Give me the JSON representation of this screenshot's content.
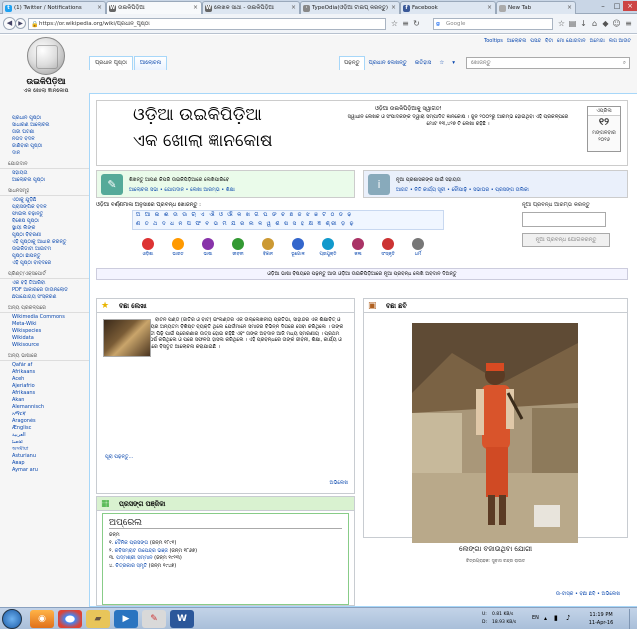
{
  "browser": {
    "tabs": [
      {
        "label": "(1) Twitter / Notifications",
        "icon": "twitter-icon",
        "color": "#1da1f2"
      },
      {
        "label": "ଉଇକିପିଡ଼ିଆ",
        "icon": "wikipedia-icon",
        "color": "#666666",
        "active": true
      },
      {
        "label": "ଲେଖକ ସାଥୀ - ଉଇକିପିଡ଼ିଆ",
        "icon": "wikipedia-icon",
        "color": "#666666"
      },
      {
        "label": "TypeOdia(ଓଡ଼ିଆ ଟାଇପ୍ କରନ୍ତୁ)",
        "icon": "page-icon",
        "color": "#888888"
      },
      {
        "label": "Facebook",
        "icon": "facebook-icon",
        "color": "#3b5998"
      },
      {
        "label": "New Tab",
        "icon": "blank-icon",
        "color": "#aaaaaa"
      }
    ],
    "url": "https://or.wikipedia.org/wiki/ପ୍ରଧାନ_ପୃଷ୍ଠା",
    "search_placeholder": "Google"
  },
  "wiki": {
    "personal_links": [
      "Tooltips",
      "ଆଲୋଚନା",
      "ପସନ୍ଦ",
      "ବିଟା",
      "ମୋ ଯୋଗଦାନ",
      "ଅମେଗା",
      "ଲଗ ଆଉଟ"
    ],
    "logo_title": "ଉଇକିପିଡ଼ିଆ",
    "logo_subtitle": "ଏକ ଖୋଲା ଜ୍ଞାନକୋଷ",
    "tabs_left": [
      "ପ୍ରଧାନ ପୃଷ୍ଠା",
      "ଆଲୋଚନା"
    ],
    "tabs_right": [
      "ପଢ଼ନ୍ତୁ",
      "ପ୍ରଧାନ ଲେଖନ୍ତୁ",
      "ଇତିହାସ",
      "☆",
      "▾"
    ],
    "search_placeholder": "ଖୋଜନ୍ତୁ",
    "sidebar": [
      {
        "heading": "",
        "links": [
          "ପ୍ରଧାନ ପୃଷ୍ଠା",
          "ସାଧାରଣ ଆଲୋଚନା",
          "ତାଜା ଘଟଣା",
          "ନଗଦ ବଦଳ",
          "ଜାଣିବାର ପୃଷ୍ଠା",
          "ଦାନ"
        ]
      },
      {
        "heading": "ଯୋଗଦାନ",
        "links": [
          "ସହାୟତା",
          "ଆଲୋଚନା ପୃଷ୍ଠା"
        ]
      },
      {
        "heading": "ସାଧନସମୂହ",
        "links": [
          "ଏଠାକୁ ଯୁଡ଼ିଛି",
          "ପ୍ରାସଙ୍ଗିକ ବଦଳ",
          "ଫାଇଲ ଚଢ଼ାନ୍ତୁ",
          "ବିଶେଷ ପୃଷ୍ଠା",
          "ସ୍ଥାୟୀ ଲିଙ୍କ",
          "ପୃଷ୍ଠା ବିବରଣୀ",
          "ଏହି ପୃଷ୍ଠାକୁ ଆଧାର କରନ୍ତୁ",
          "ଉଇକିଡାଟା ଆଇଟମ",
          "ପୃଷ୍ଠା ଛାପନ୍ତୁ",
          "ଏହି ପୃଷ୍ଠା ବାବଦରେ"
        ]
      },
      {
        "heading": "ପ୍ରିଣ୍ଟ/ଏକ୍ସପୋର୍ଟ",
        "links": [
          "ଏକ ବହି ତିଆରିବା",
          "PDF ଆକାରରେ ଡାଉନଲୋଡ",
          "ଛପାଯୋଗ୍ୟ ସଂସ୍କରଣ"
        ]
      },
      {
        "heading": "ଅନ୍ୟ ପ୍ରକଳ୍ପରେ",
        "links": [
          "Wikimedia Commons",
          "Meta-Wiki",
          "Wikispecies",
          "Wikidata",
          "Wikisource"
        ]
      },
      {
        "heading": "ଅନ୍ୟ ଭାଷାରେ",
        "links": [
          "Qafár af",
          "Afrikaans",
          "Aceh",
          "Ajeriafrio",
          "Afrikaans",
          "Akan",
          "Alemannisch",
          "አማርኛ",
          "Aragonés",
          "Ænglisc",
          "العربية",
          "ܐܪܡܝܐ",
          "অসমীয়া",
          "Asturianu",
          "Авар",
          "Aymar aru"
        ]
      }
    ],
    "welcome": {
      "title1": "ଓଡ଼ିଆ ଉଇକିପିଡ଼ିଆ",
      "title2": "ଏକ ଖୋଲା ଜ୍ଞାନକୋଷ",
      "welcome_line": "ଓଡ଼ିଆ ଉଇକିପିଡ଼ିଆକୁ ସ୍ୱାଗତ!",
      "description": "ସ୍ୱାଧୀନ ଲେଖକ ଓ ସଂପାଦକଙ୍କ ଦ୍ୱାରା ସମ୍ପାଦିତ ଜ୍ଞାନକୋଷ । ଜୁନ ୨୦୦୨ରୁ ଆରମ୍ଭ ହୋଇଥିବା ଏହି ପ୍ରକଳ୍ପରେ ମୋଟ ୧୩,୪୨୭ ଟି ଲେଖା ରହିଛି ।"
    },
    "calendar": {
      "month": "ଏପ୍ରିଲ",
      "day": "୧୨",
      "weekday": "ମଙ୍ଗଳବାର",
      "year": "୨୦୧୬"
    },
    "info_left": {
      "line1": "ଶିଖନ୍ତୁ ଆପଣ କିପରି ଉଇକିପିଡ଼ିଆରେ ଲେଖିପାରିବେ",
      "line2": "ଆଲୋଚନା ସଭା • ଯୋଗଦାନ • ଲେଖା ଆରମ୍ଭ • ଶିକ୍ଷା"
    },
    "info_right": {
      "line1": "ନୂଆ ପ୍ରଶାସକଙ୍କ ପାଇଁ ସହାୟତା",
      "line2": "ଆଗତ • ନିତି କାର୍ଯ୍ୟ ସୂଚୀ • ଚୌପାଢ଼ି • ସଭାଘର • ପ୍ରସଙ୍ଗ ତାଲିକା"
    },
    "browse_label": "ଓଡ଼ିଆ ବର୍ଣ୍ଣମାଳା ଅନୁସାରେ ପ୍ରବନ୍ଧ ଖୋଜନ୍ତୁ :",
    "alphabet_rows": [
      "ଅ ଆ ଇ ଈ ଉ ଊ ଋ ଏ ଐ ଓ ଔ କ ଖ ଗ ଘ ଙ ଚ ଛ ଜ ଝ ଞ ଟ ଠ ଡ ଢ",
      "ଣ ତ ଥ ଦ ଧ ନ ପ ଫ ବ ଭ ମ ଯ ର ଲ ଳ ୱ ଶ ଷ ସ ହ କ୍ଷ ଜ୍ଞ ଶ୍ରୀ ଡ଼ ଢ଼"
    ],
    "portals": [
      {
        "label": "ଓଡ଼ିଶା",
        "color": "#d33"
      },
      {
        "label": "ଭାରତ",
        "color": "#f90"
      },
      {
        "label": "ଭାଷା",
        "color": "#83a"
      },
      {
        "label": "ଜୀବନୀ",
        "color": "#393"
      },
      {
        "label": "ବିଜ୍ଞାନ",
        "color": "#c93"
      },
      {
        "label": "ଭୂଗୋଳ",
        "color": "#36c"
      },
      {
        "label": "ପ୍ରଯୁକ୍ତି",
        "color": "#19c"
      },
      {
        "label": "କଳା",
        "color": "#a36"
      },
      {
        "label": "ସଂସ୍କୃତି",
        "color": "#c33"
      },
      {
        "label": "ଧର୍ମ",
        "color": "#777"
      }
    ],
    "search_box": {
      "label": "ନୂଆ ପ୍ରବନ୍ଧ ଆରମ୍ଭ କରନ୍ତୁ",
      "button": "ନୂଆ ପ୍ରବନ୍ଧ ଯୋଗକରନ୍ତୁ"
    },
    "notice": "ଓଡ଼ିଆ ଭାଷା ବିଷୟରେ ପଢ଼ନ୍ତୁ ଆଉ ଓଡ଼ିଆ ଉଇକିପିଡ଼ିଆରେ ନୂଆ ପ୍ରବନ୍ଧ ଲେଖି ଅବଦାନ ଦିଅନ୍ତୁ",
    "featured": {
      "heading": "ବଛା ଲେଖା",
      "text": "ବାଟନ ପଣ୍ଡ (ଜାତିର ଓ ବାଟ) ଇଂଲଣ୍ଡର ଏକ ଉଲ୍ଲେଖନୀୟ ପ୍ରତିଭା, ସାହାନ୍ଦର ଏକ ଶିକ୍ଷାବିତ୍ ଓ ଲେଖକ । ସେ ତାଙ୍କ ସମୟର ଅନ୍ୟତମ ବିଶିଷ୍ଟ ବ୍ୟକ୍ତି ଥିଲେ ଯେଉଁମାନେ ସମାଜର ବିଭିନ୍ନ ଦିଗରେ ସେବା କରିଥିଲେ । ତାଙ୍କ ଜୀବନ ଓ କାର୍ଯ୍ୟ ପରବର୍ତ୍ତୀ ପିଢ଼ି ପାଇଁ ପ୍ରେରଣାର ଉତ୍ସ ହୋଇ ରହିଛି ଏବଂ ତାଙ୍କ ଅବଦାନ ଆଜି ମଧ୍ୟ ସ୍ମରଣୀୟ । ପ୍ରଥମ ଜୀବନରେ ସେ ଅନେକ ସଂଘର୍ଷ କରିଥିଲେ ଓ ପରେ ସଫଳତା ହାସଲ କରିଥିଲେ । ଏହି ପ୍ରବନ୍ଧରେ ତାଙ୍କ ଜୀବନୀ, ଶିକ୍ଷା, କାର୍ଯ୍ୟ ଓ ସାହିତ୍ୟିକ ଅବଦାନ ବିଷୟରେ ବିସ୍ତୃତ ଆଲୋଚନା କରାଯାଇଛି ।",
      "more": "ପୂରା ପଢ଼ନ୍ତୁ...",
      "archive": "ଅଭିଲେଖ"
    },
    "picture": {
      "heading": "ବଛା ଛବି",
      "caption": "ଲେଙ୍ଗା ବଜାଉଥିବା ଯୋଗୀ",
      "credit": "ଚିତ୍ରଗ୍ରାହକ: ସୁବାସ ଚନ୍ଦ୍ର ରାଉତ"
    },
    "extra_links": "ଉ-ଟାସ୍କ  •  ବଛା ଛବି  •  ଅଭିଲେଖ",
    "dyk": {
      "heading": "ପ୍ରସଙ୍ଗ ପଞ୍ଜିକା",
      "month": "ଅପ୍ରେଲ",
      "sub": "ଜନ୍ମ",
      "items": [
        {
          "num": "୧.",
          "name": "ଦୈନିକ ପ୍ରସଙ୍ଗ",
          "rest": "(ଜନ୍ମ ୧୮୯୧)"
        },
        {
          "num": "୨.",
          "name": "କବିସମ୍ରାଟ ଉପେନ୍ଦ୍ର ଭଞ୍ଜ",
          "rest": "(ଜନ୍ମ ୧୮୬୭)"
        },
        {
          "num": "୩.",
          "name": "ପଦ୍ମଶ୍ରୀ ସମ୍ମାନ",
          "rest": "(ଜନ୍ମ ୧୯୨୩)"
        },
        {
          "num": "୪.",
          "name": "ଚିତ୍ରକାର ସ୍ମୃତି",
          "rest": "(ଜନ୍ମ ୧୯୪୭)"
        }
      ]
    }
  },
  "taskbar": {
    "apps": [
      "start",
      "firefox",
      "chrome",
      "explorer",
      "media",
      "paint",
      "word"
    ],
    "network_up": "0.81 KB/s",
    "network_down": "18.93 KB/s",
    "lang": "EN",
    "time": "11:19 PM",
    "date": "11-Apr-16"
  }
}
